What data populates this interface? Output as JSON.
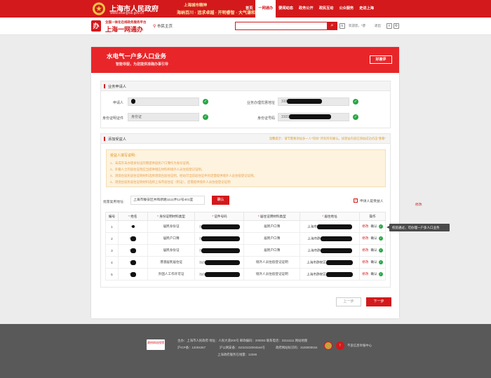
{
  "header": {
    "site_title": "上海市人民政府",
    "site_url": "www.shanghai.gov.cn",
    "slogan_top": "上海城市精神",
    "slogan_bottom": "海纳百川 · 追求卓越 · 开明睿智 · 大气谦和",
    "nav": [
      "首页",
      "一网通办",
      "要闻动态",
      "政务公开",
      "政民互动",
      "公众服务",
      "走进上海"
    ],
    "nav_active_index": 1
  },
  "subheader": {
    "brand_sub": "全国一体化在线政务服务平台",
    "brand_name": "上海一网通办",
    "location": "市民主页",
    "search_placeholder": "",
    "greeting": "欢迎您，*彦",
    "logout": "退出"
  },
  "banner": {
    "title": "水电气一户多人口业务",
    "subtitle": "智能导服，为您提供准确办事引导",
    "rate_button": "好差评"
  },
  "applicant_section": {
    "title": "业务申请人",
    "fields": {
      "name_label": "申请人",
      "name_value": "",
      "address_label": "业务办理优惠地址",
      "address_value": "310",
      "id_type_label": "身份证明证件",
      "id_type_value": "身份证",
      "id_no_label": "身份证号码",
      "id_no_value": "3101"
    }
  },
  "recipient_section": {
    "title": "添加受益人",
    "tip": "温馨提示：请节需要添加多一人\"何如\" 所有所有确认。如受益内容已添加成功点击\"重看\""
  },
  "notice": {
    "title": "受益人填写说明：",
    "lines": [
      "1、未成年未办理身份证的需提供居民户口簿作为身份证明。",
      "2、外籍人士的居住证明应当提供相应材料和境外人员住宿登记证明。",
      "3、港澳台居民居住证明材料选择港澳台居住证明，经站可当前居住证件的还需提供境外人员住宿登记证明。",
      "4、港澳台居民居住证明材料选择上海市居住证（积证），还需提供境外人员住宿登记证明"
    ]
  },
  "batch": {
    "label": "批量复用地址:",
    "value": "上海市静安区共和新路1111弄12号401室",
    "confirm": "确认",
    "applicant_check_label": "申请人是受益人",
    "float_edit": "修改"
  },
  "table": {
    "headers": [
      "编号",
      "姓名",
      "身份证明材料类型",
      "证件号码",
      "居住证明材料类型",
      "居住地址",
      "操作"
    ],
    "header_required": [
      false,
      true,
      true,
      true,
      true,
      true,
      false
    ],
    "rows": [
      {
        "no": "1",
        "name": "*",
        "id_type": "居民身份证",
        "id_no": "3",
        "res_type": "居民户口簿",
        "address": "上海市",
        "edit": "修改",
        "ok": "确认"
      },
      {
        "no": "2",
        "name": "*",
        "id_type": "居民户口簿",
        "id_no": "3",
        "res_type": "居民户口簿",
        "address": "上海市静",
        "edit": "修改",
        "ok": "确认"
      },
      {
        "no": "3",
        "name": "*",
        "id_type": "居民身份证",
        "id_no": "3",
        "res_type": "居民户口簿",
        "address": "上海市静",
        "edit": "修改",
        "ok": "确认"
      },
      {
        "no": "4",
        "name": "*",
        "id_type": "港澳居民居住证",
        "id_no": "310",
        "res_type": "境外人员住宿登记证明",
        "address": "上海市静安区",
        "edit": "修改",
        "ok": "确认"
      },
      {
        "no": "5",
        "name": "*",
        "id_type": "外国人工作许可证",
        "id_no": "310",
        "res_type": "境外人员住宿登记证明",
        "address": "上海市静安区",
        "edit": "修改",
        "ok": "确认"
      }
    ]
  },
  "tooltip": "校验通过，可办理一户多人口业务",
  "buttons": {
    "prev": "上一步",
    "next": "下一步"
  },
  "footer": {
    "badge": "政府网站找错",
    "sponsor": "主办：上海市人民政府    地址：人民大道200号    邮政编码：200003    联系电话：23111111    网站地图",
    "icp": "沪ICP备：12004267",
    "beian": "沪公网安备：31010102004544号",
    "site_code": "政府网站标识码：3100000044",
    "counter": "上海政府服务在线量：12346",
    "report": "不良信息举报中心"
  }
}
